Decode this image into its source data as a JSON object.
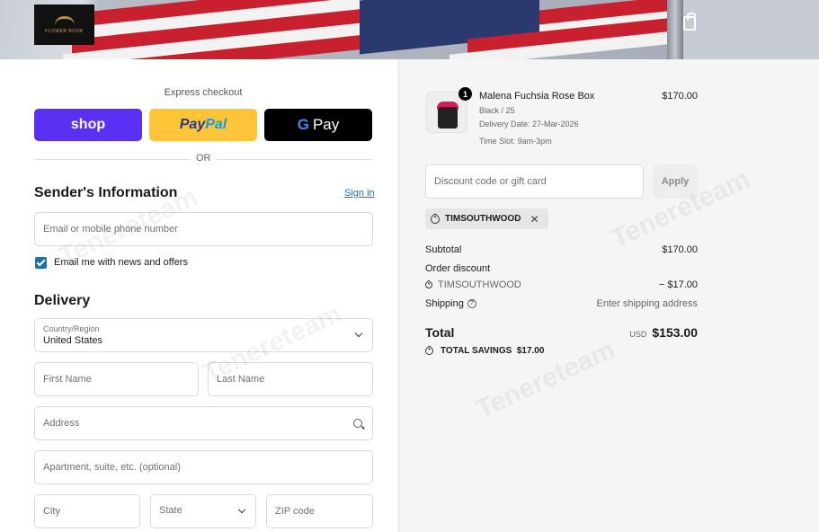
{
  "header": {
    "logo_text": "FLOWER BOOK"
  },
  "express": {
    "label": "Express checkout",
    "shop": "shop",
    "paypal_a": "Pay",
    "paypal_b": "Pal",
    "gpay_g": "G",
    "gpay_text": "Pay",
    "or": "OR"
  },
  "sender": {
    "title": "Sender's Information",
    "signin": "Sign in",
    "email_placeholder": "Email or mobile phone number",
    "news_label": "Email me with news and offers",
    "news_checked": true
  },
  "delivery": {
    "title": "Delivery",
    "country_label": "Country/Region",
    "country_value": "United States",
    "first_name": "First Name",
    "last_name": "Last Name",
    "address": "Address",
    "apartment": "Apartment, suite, etc. (optional)",
    "city": "City",
    "state": "State",
    "zip": "ZIP code"
  },
  "order": {
    "item": {
      "qty": "1",
      "name": "Malena Fuchsia Rose Box",
      "variant": "Black / 25",
      "delivery_date": "Delivery Date: 27-Mar-2026",
      "time_slot": "Time Slot: 9am-3pm",
      "price": "$170.00"
    },
    "discount_placeholder": "Discount code or gift card",
    "apply": "Apply",
    "code": "TIMSOUTHWOOD",
    "subtotal_label": "Subtotal",
    "subtotal": "$170.00",
    "order_discount_label": "Order discount",
    "discount_code": "TIMSOUTHWOOD",
    "discount_amount": "− $17.00",
    "shipping_label": "Shipping",
    "shipping_value": "Enter shipping address",
    "total_label": "Total",
    "currency": "USD",
    "total": "$153.00",
    "savings": "TOTAL SAVINGS  $17.00"
  },
  "watermark": "Tenereteam"
}
